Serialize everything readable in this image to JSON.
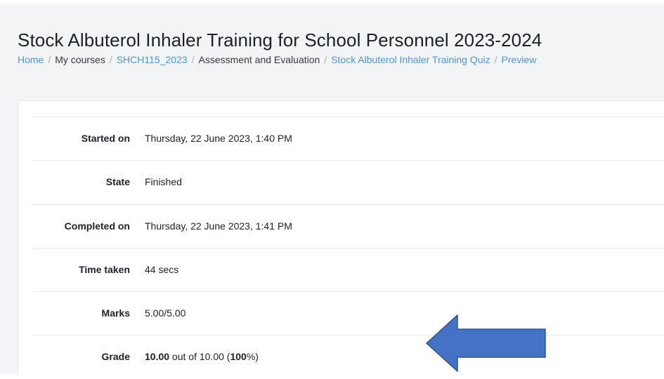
{
  "header": {
    "title": "Stock Albuterol Inhaler Training for School Personnel 2023-2024"
  },
  "breadcrumb": {
    "home": "Home",
    "my_courses": "My courses",
    "course": "SHCH115_2023",
    "section": "Assessment and Evaluation",
    "quiz": "Stock Albuterol Inhaler Training Quiz",
    "preview": "Preview",
    "separator": "/"
  },
  "summary": {
    "started_on": {
      "label": "Started on",
      "value": "Thursday, 22 June 2023, 1:40 PM"
    },
    "state": {
      "label": "State",
      "value": "Finished"
    },
    "completed_on": {
      "label": "Completed on",
      "value": "Thursday, 22 June 2023, 1:41 PM"
    },
    "time_taken": {
      "label": "Time taken",
      "value": "44 secs"
    },
    "marks": {
      "label": "Marks",
      "value": "5.00/5.00"
    },
    "grade": {
      "label": "Grade",
      "score": "10.00",
      "out_of_text": " out of 10.00 (",
      "percent": "100",
      "percent_suffix": "%)"
    }
  },
  "colors": {
    "link": "#4f94d4",
    "arrow_fill": "#4472c4",
    "arrow_stroke": "#2f528f",
    "page_background": "#f2f4f5"
  },
  "icons": {
    "annotation_arrow": "left-arrow-icon"
  }
}
